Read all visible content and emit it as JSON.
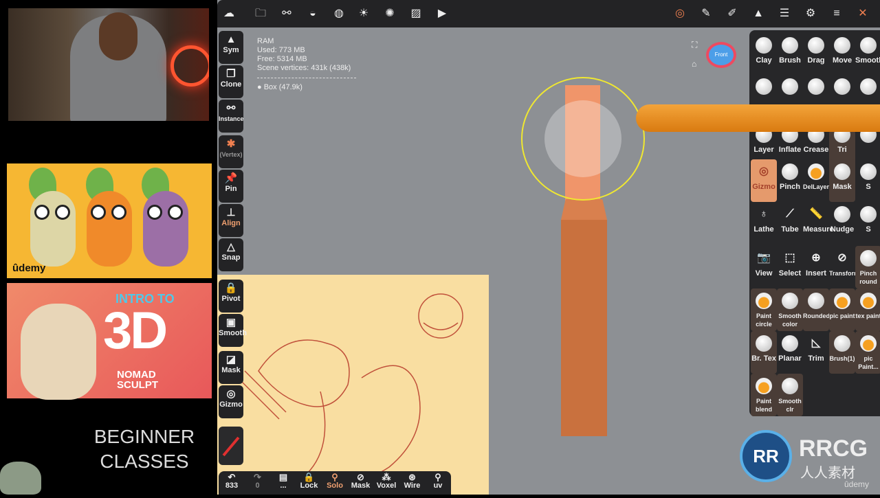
{
  "left_panel": {
    "course1_brand": "ûdemy",
    "course2": {
      "intro": "INTRO TO",
      "big": "3D",
      "nomad": "NOMAD",
      "sculpt": "SCULPT"
    },
    "beginner": "BEGINNER",
    "classes": "CLASSES"
  },
  "top_toolbar": [
    {
      "icon": "nomad-logo-icon",
      "x": 0
    },
    {
      "icon": "folder-icon"
    },
    {
      "icon": "scene-tree-icon"
    },
    {
      "icon": "material-icon"
    },
    {
      "icon": "topology-icon"
    },
    {
      "icon": "light-icon"
    },
    {
      "icon": "postprocess-icon"
    },
    {
      "icon": "background-icon"
    },
    {
      "icon": "video-icon"
    },
    {
      "icon": "gizmo-icon"
    },
    {
      "icon": "brush-pen-icon"
    },
    {
      "icon": "stroke-icon"
    },
    {
      "icon": "symmetry-icon"
    },
    {
      "icon": "layers-icon"
    },
    {
      "icon": "settings-icon"
    },
    {
      "icon": "interface-icon"
    },
    {
      "icon": "tools-icon"
    }
  ],
  "left_tools": [
    {
      "label": "Sym",
      "icon": "▲"
    },
    {
      "label": "Clone",
      "icon": "❐"
    },
    {
      "label": "Instance",
      "icon": "⚯"
    },
    {
      "label": "(Vertex)",
      "icon": "✱"
    },
    {
      "label": "Pin",
      "icon": "📌"
    },
    {
      "label": "Align",
      "icon": "⊥"
    },
    {
      "label": "Snap",
      "icon": "△"
    },
    {
      "label": "Pivot",
      "icon": "🔒"
    },
    {
      "label": "Smooth",
      "icon": "▣"
    },
    {
      "label": "Mask",
      "icon": "◪"
    },
    {
      "label": "Gizmo",
      "icon": "◎"
    }
  ],
  "stats": {
    "title": "RAM",
    "used": "Used: 773 MB",
    "free": "Free: 5314 MB",
    "vertices": "Scene vertices: 431k (438k)",
    "object": "Box (47.9k)"
  },
  "view_cube": {
    "label": "Front"
  },
  "tools": [
    [
      "Clay",
      "Brush",
      "Drag",
      "Move",
      "Smooth"
    ],
    [
      "",
      "",
      "",
      "",
      ""
    ],
    [
      "Layer",
      "Inflate",
      "Crease",
      "Tri",
      ""
    ],
    [
      "Gizmo",
      "Pinch",
      "DelLayer",
      "Mask",
      "S"
    ],
    [
      "Lathe",
      "Tube",
      "Measure",
      "Nudge",
      "S"
    ],
    [
      "View",
      "Select",
      "Insert",
      "Transform",
      "Pinch round"
    ],
    [
      "Paint circle",
      "Smooth color",
      "Rounded...",
      "pic paint",
      "tex paint"
    ],
    [
      "Br. Tex",
      "Planar",
      "Trim",
      "Brush(1)",
      "pic Paint..."
    ],
    [
      "Paint blend",
      "Smooth clr"
    ]
  ],
  "selected_tool": "Gizmo",
  "bottom_toolbar": [
    {
      "label": "833",
      "icon": "↶"
    },
    {
      "label": "0",
      "icon": "↷"
    },
    {
      "label": "...",
      "icon": "▤"
    },
    {
      "label": "Lock",
      "icon": "🔒"
    },
    {
      "label": "Solo",
      "icon": "⚲"
    },
    {
      "label": "Mask",
      "icon": "⊘"
    },
    {
      "label": "Voxel",
      "icon": "⁂"
    },
    {
      "label": "Wire",
      "icon": "⊛"
    },
    {
      "label": "uv",
      "icon": "⚲"
    }
  ],
  "watermark": {
    "logo": "RR",
    "title": "RRCG",
    "subtitle": "人人素材",
    "udemy": "ûdemy"
  },
  "colors": {
    "accent": "#e59a6c",
    "object": "#c9713e",
    "viewport": "#8d9094",
    "toolbar": "#232325"
  }
}
